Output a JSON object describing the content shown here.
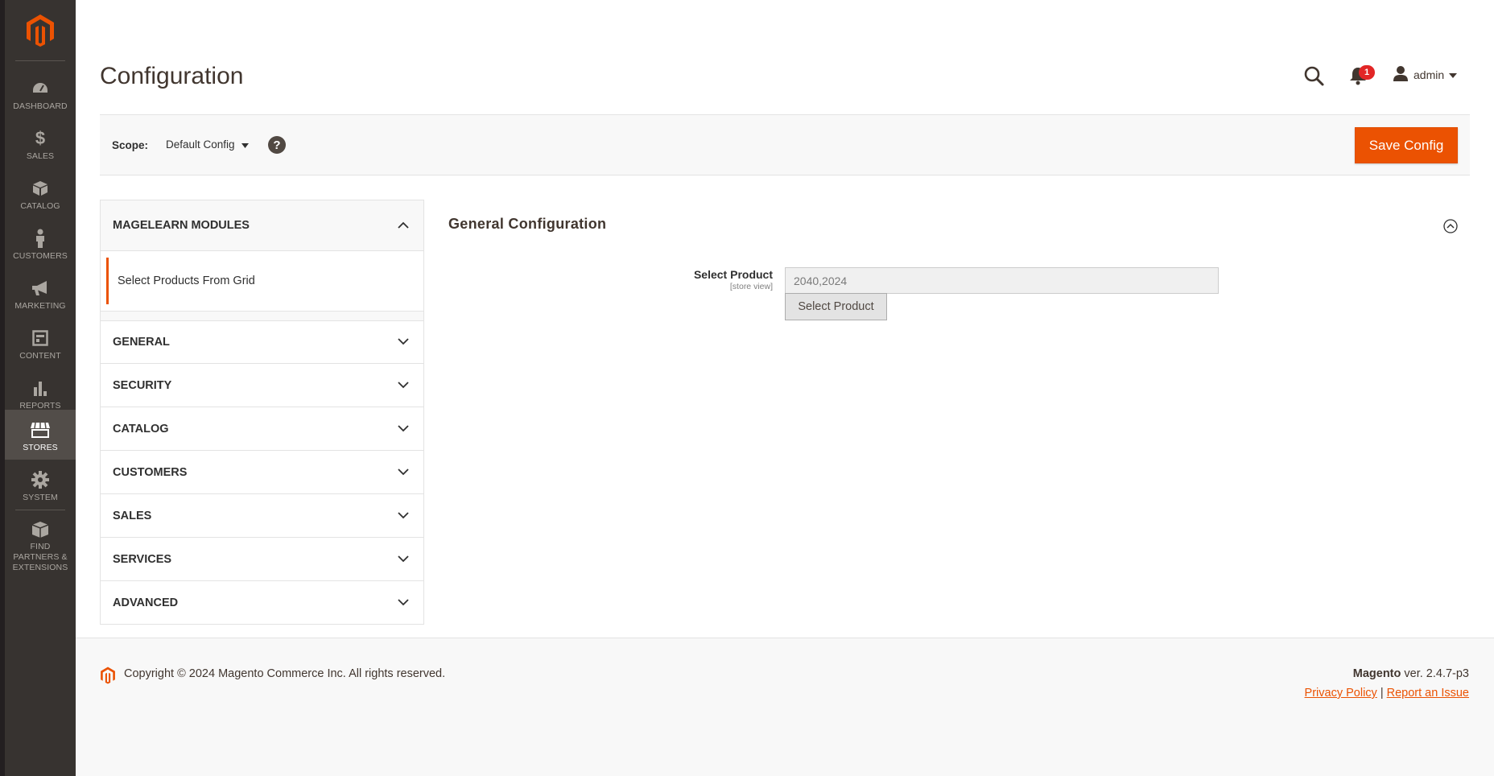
{
  "colors": {
    "accent": "#eb5202",
    "menu_bg": "#373330",
    "badge": "#e22626"
  },
  "menu": {
    "logo_icon": "magento-logo-icon",
    "items": [
      {
        "label": "Dashboard",
        "icon": "dashboard-icon"
      },
      {
        "label": "Sales",
        "icon": "dollar-icon"
      },
      {
        "label": "Catalog",
        "icon": "box-icon"
      },
      {
        "label": "Customers",
        "icon": "person-icon"
      },
      {
        "label": "Marketing",
        "icon": "megaphone-icon"
      },
      {
        "label": "Content",
        "icon": "layout-icon"
      },
      {
        "label": "Reports",
        "icon": "bar-chart-icon"
      },
      {
        "label": "Stores",
        "icon": "storefront-icon",
        "active": true
      },
      {
        "label": "System",
        "icon": "gear-icon"
      },
      {
        "label": "Find Partners & Extensions",
        "icon": "cubes-icon"
      }
    ]
  },
  "header": {
    "title": "Configuration",
    "notification_count": "1",
    "user_name": "admin"
  },
  "scope": {
    "label": "Scope:",
    "value": "Default Config",
    "help": "?",
    "save_label": "Save Config"
  },
  "tabs": {
    "active_group": "MAGELEARN MODULES",
    "active_item": "Select Products From Grid",
    "groups": [
      "GENERAL",
      "SECURITY",
      "CATALOG",
      "CUSTOMERS",
      "SALES",
      "SERVICES",
      "ADVANCED"
    ]
  },
  "main": {
    "section_title": "General Configuration",
    "field_label": "Select Product",
    "field_scope": "[store view]",
    "field_value": "2040,2024",
    "field_button": "Select Product"
  },
  "footer": {
    "copyright": "Copyright © 2024 Magento Commerce Inc. All rights reserved.",
    "brand": "Magento",
    "version": " ver. 2.4.7-p3",
    "privacy": "Privacy Policy",
    "separator": " | ",
    "report": "Report an Issue"
  }
}
